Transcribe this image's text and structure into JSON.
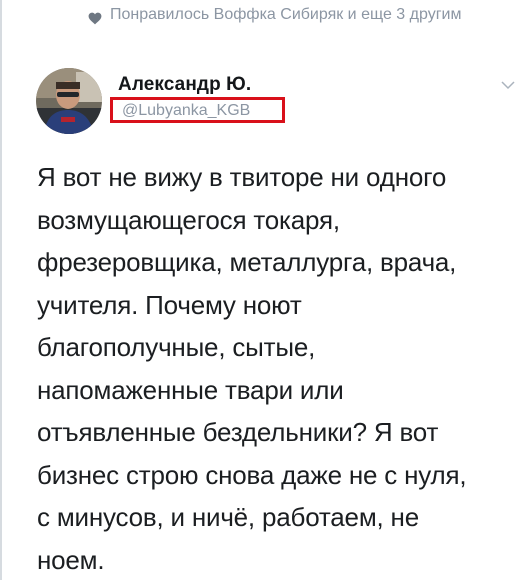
{
  "liked": {
    "text": "Понравилось Воффка Сибиряк и еще 3 другим"
  },
  "tweet": {
    "author_name": "Александр Ю.",
    "handle": "@Lubyanka_KGB",
    "text_lines": [
      "Я вот не вижу в твиторе ни одного",
      "возмущающегося токаря,",
      "фрезеровщика, металлурга, врача,",
      "учителя. Почему ноют",
      "благополучные, сытые,",
      "напомаженные твари или",
      "отъявленные бездельники? Я вот",
      "бизнес строю снова даже не с нуля,",
      "с минусов, и ничё, работаем, не",
      "ноем."
    ]
  },
  "icons": {
    "heart": "heart-icon",
    "menu": "chevron-down-icon",
    "avatar": "avatar"
  },
  "colors": {
    "muted": "#8c96a3",
    "text": "#1b1e21",
    "highlight": "#d9101a"
  }
}
